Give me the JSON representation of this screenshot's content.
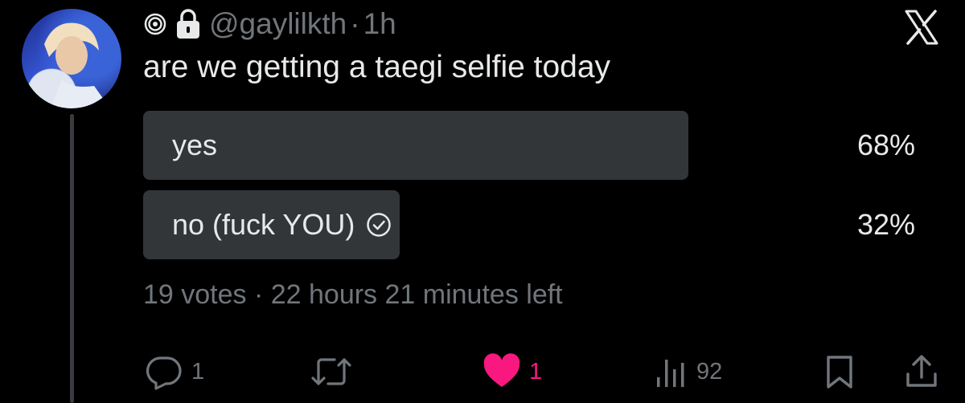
{
  "tweet": {
    "handle": "@gaylilkth",
    "separator": "·",
    "time": "1h",
    "text": "are we getting a taegi selfie today"
  },
  "poll": {
    "options": [
      {
        "label": "yes",
        "percent_text": "68%",
        "percent": 68,
        "selected": false
      },
      {
        "label": "no (fuck YOU)",
        "percent_text": "32%",
        "percent": 32,
        "selected": true
      }
    ],
    "meta": "19 votes · 22 hours 21 minutes left"
  },
  "actions": {
    "replies": "1",
    "likes": "1",
    "views": "92"
  },
  "icons": {
    "circle-badge": "spiral-circle-icon",
    "lock": "lock-icon",
    "brand": "x-logo-icon",
    "reply": "reply-icon",
    "retweet": "retweet-icon",
    "like": "heart-icon",
    "views": "views-icon",
    "bookmark": "bookmark-icon",
    "share": "share-icon",
    "selected": "check-circle-icon"
  },
  "colors": {
    "background": "#000000",
    "text": "#e7e9ea",
    "muted": "#71767b",
    "bar": "#333639",
    "like": "#f91880"
  }
}
